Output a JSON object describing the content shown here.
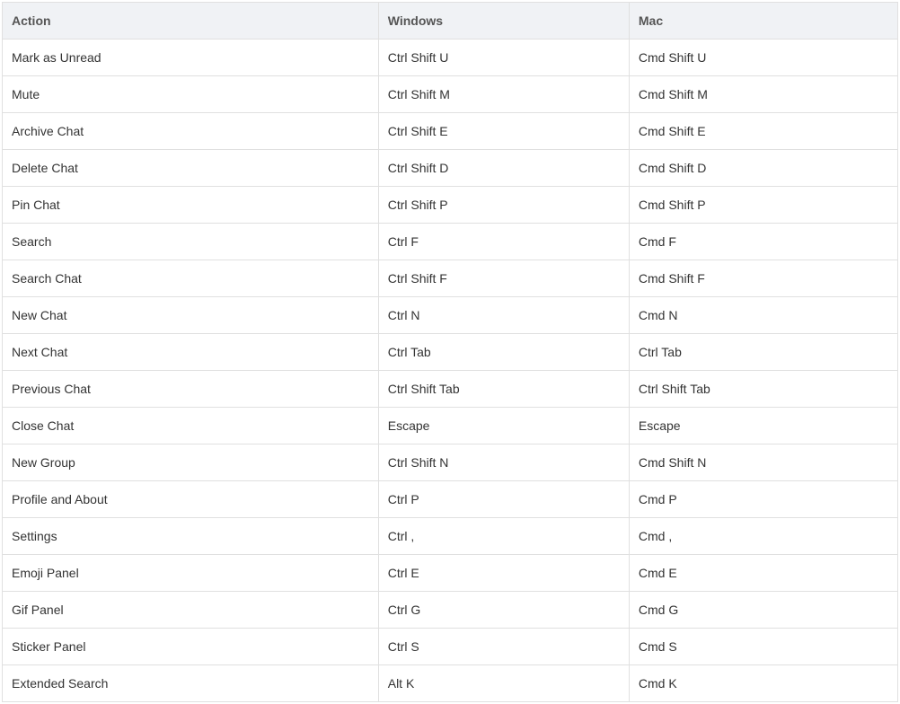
{
  "table": {
    "headers": {
      "action": "Action",
      "windows": "Windows",
      "mac": "Mac"
    },
    "rows": [
      {
        "action": "Mark as Unread",
        "windows": "Ctrl Shift U",
        "mac": "Cmd Shift U"
      },
      {
        "action": "Mute",
        "windows": "Ctrl Shift M",
        "mac": "Cmd Shift M"
      },
      {
        "action": "Archive Chat",
        "windows": "Ctrl Shift E",
        "mac": "Cmd Shift E"
      },
      {
        "action": "Delete Chat",
        "windows": "Ctrl Shift D",
        "mac": "Cmd Shift D"
      },
      {
        "action": "Pin Chat",
        "windows": "Ctrl Shift P",
        "mac": "Cmd Shift P"
      },
      {
        "action": "Search",
        "windows": "Ctrl F",
        "mac": "Cmd F"
      },
      {
        "action": "Search Chat",
        "windows": "Ctrl Shift F",
        "mac": "Cmd Shift F"
      },
      {
        "action": "New Chat",
        "windows": "Ctrl N",
        "mac": "Cmd N"
      },
      {
        "action": "Next Chat",
        "windows": "Ctrl Tab",
        "mac": "Ctrl Tab"
      },
      {
        "action": "Previous Chat",
        "windows": "Ctrl Shift Tab",
        "mac": "Ctrl Shift Tab"
      },
      {
        "action": "Close Chat",
        "windows": "Escape",
        "mac": "Escape"
      },
      {
        "action": "New Group",
        "windows": "Ctrl Shift N",
        "mac": "Cmd Shift N"
      },
      {
        "action": "Profile and About",
        "windows": "Ctrl P",
        "mac": "Cmd P"
      },
      {
        "action": "Settings",
        "windows": "Ctrl ,",
        "mac": "Cmd ,"
      },
      {
        "action": "Emoji Panel",
        "windows": "Ctrl E",
        "mac": "Cmd E"
      },
      {
        "action": "Gif Panel",
        "windows": "Ctrl G",
        "mac": "Cmd G"
      },
      {
        "action": "Sticker Panel",
        "windows": "Ctrl S",
        "mac": "Cmd S"
      },
      {
        "action": "Extended Search",
        "windows": "Alt K",
        "mac": "Cmd K"
      }
    ]
  }
}
